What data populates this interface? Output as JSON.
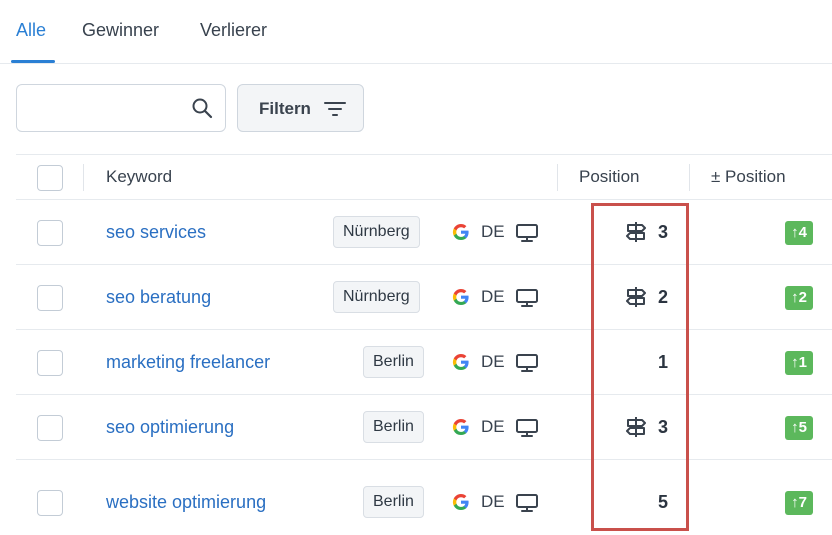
{
  "tabs": [
    {
      "label": "Alle",
      "active": true
    },
    {
      "label": "Gewinner",
      "active": false
    },
    {
      "label": "Verlierer",
      "active": false
    }
  ],
  "search": {
    "value": "",
    "placeholder": ""
  },
  "filter": {
    "label": "Filtern"
  },
  "table": {
    "headers": {
      "keyword": "Keyword",
      "position": "Position",
      "delta": "± Position"
    },
    "rows": [
      {
        "keyword": "seo services",
        "location": "Nürnberg",
        "engine": "google-icon",
        "country": "DE",
        "device": "desktop-icon",
        "feature_icon": "signpost-icon",
        "position": "3",
        "delta": "↑4"
      },
      {
        "keyword": "seo beratung",
        "location": "Nürnberg",
        "engine": "google-icon",
        "country": "DE",
        "device": "desktop-icon",
        "feature_icon": "signpost-icon",
        "position": "2",
        "delta": "↑2"
      },
      {
        "keyword": "marketing freelancer",
        "location": "Berlin",
        "engine": "google-icon",
        "country": "DE",
        "device": "desktop-icon",
        "feature_icon": null,
        "position": "1",
        "delta": "↑1"
      },
      {
        "keyword": "seo optimierung",
        "location": "Berlin",
        "engine": "google-icon",
        "country": "DE",
        "device": "desktop-icon",
        "feature_icon": "signpost-icon",
        "position": "3",
        "delta": "↑5"
      },
      {
        "keyword": "website optimierung",
        "location": "Berlin",
        "engine": "google-icon",
        "country": "DE",
        "device": "desktop-icon",
        "feature_icon": null,
        "position": "5",
        "delta": "↑7"
      }
    ]
  },
  "colors": {
    "accent": "#2a7fd4",
    "link": "#2a6fc2",
    "delta_badge": "#5cb85c",
    "highlight_box": "#c9504b"
  }
}
